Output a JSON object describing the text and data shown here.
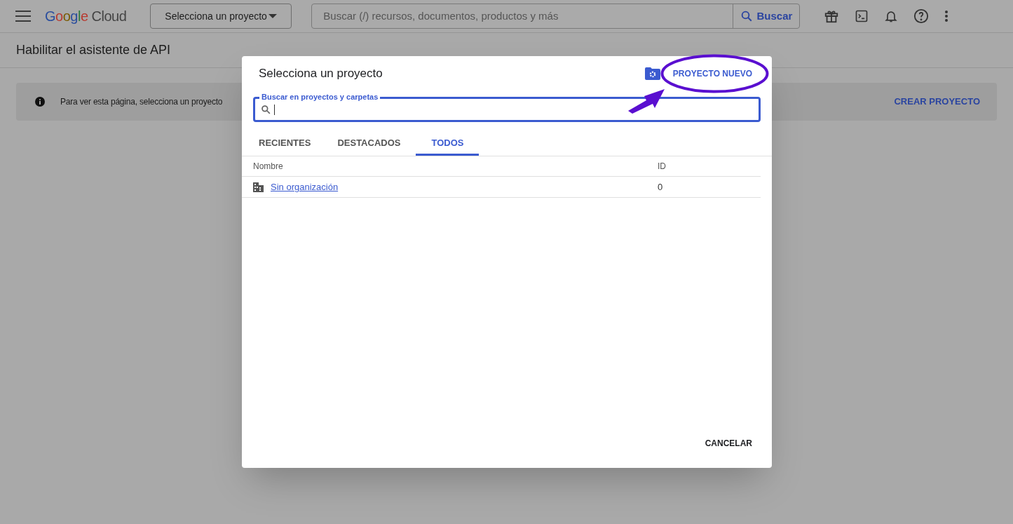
{
  "header": {
    "logo": "Google Cloud",
    "project_picker": "Selecciona un proyecto",
    "search": {
      "placeholder": "Buscar (/) recursos, documentos, productos y más",
      "button": "Buscar"
    }
  },
  "page_title": "Habilitar el asistente de API",
  "banner": {
    "text": "Para ver esta página, selecciona un proyecto",
    "action": "CREAR PROYECTO"
  },
  "dialog": {
    "title": "Selecciona un proyecto",
    "new_project": "PROYECTO NUEVO",
    "search": {
      "label": "Buscar en proyectos y carpetas",
      "focused": true
    },
    "tabs": [
      {
        "label": "RECIENTES",
        "selected": false
      },
      {
        "label": "DESTACADOS",
        "selected": false
      },
      {
        "label": "TODOS",
        "selected": true
      }
    ],
    "table": {
      "columns": [
        "Nombre",
        "ID"
      ],
      "rows": [
        {
          "name": "Sin organización",
          "id": "0"
        }
      ]
    },
    "cancel": "CANCELAR"
  }
}
